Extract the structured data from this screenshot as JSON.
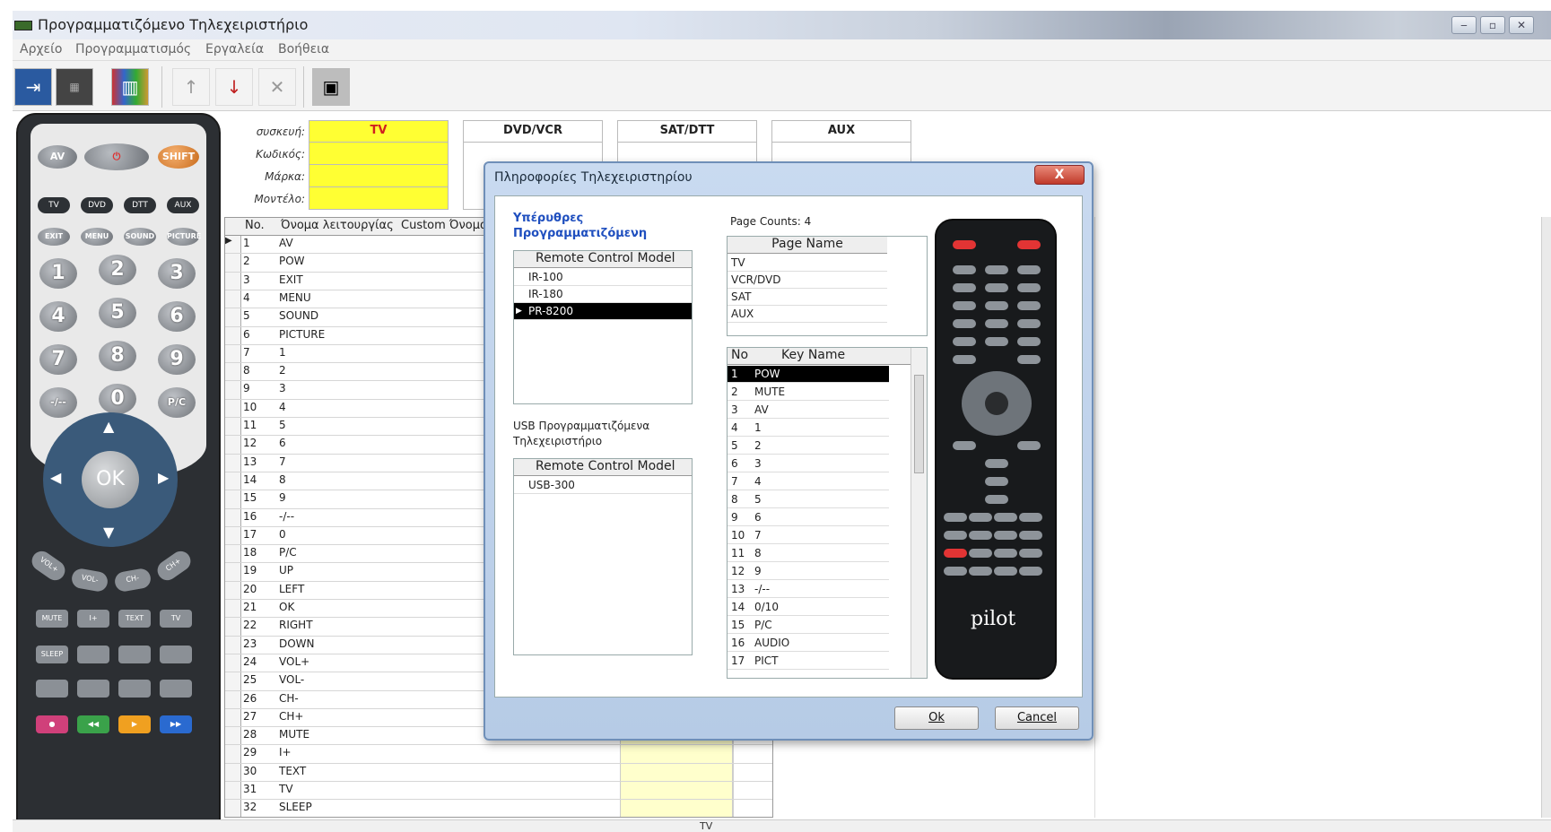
{
  "window": {
    "title": "Προγραμματιζόμενο Τηλεχειριστήριο",
    "controls": [
      "minimize",
      "maximize",
      "close"
    ]
  },
  "menu": [
    "Αρχείο",
    "Προγραμματισμός",
    "Εργαλεία",
    "Βοήθεια"
  ],
  "toolbar": {
    "buttons": [
      "import-icon",
      "chip-icon",
      "books-icon",
      "up-arrow-icon",
      "down-arrow-icon",
      "delete-icon",
      "gray-square-icon"
    ]
  },
  "device_fields": {
    "labels": [
      "συσκευή:",
      "Κωδικός:",
      "Μάρκα:",
      "Μοντέλο:"
    ],
    "tabs": [
      "TV",
      "DVD/VCR",
      "SAT/DTT",
      "AUX"
    ],
    "active_tab": "TV",
    "active_color": "#ffff33"
  },
  "grid": {
    "headers": [
      "No.",
      "Όνομα λειτουργίας",
      "Custom Όνομα"
    ],
    "rows": [
      [
        "1",
        "AV"
      ],
      [
        "2",
        "POW"
      ],
      [
        "3",
        "EXIT"
      ],
      [
        "4",
        "MENU"
      ],
      [
        "5",
        "SOUND"
      ],
      [
        "6",
        "PICTURE"
      ],
      [
        "7",
        "1"
      ],
      [
        "8",
        "2"
      ],
      [
        "9",
        "3"
      ],
      [
        "10",
        "4"
      ],
      [
        "11",
        "5"
      ],
      [
        "12",
        "6"
      ],
      [
        "13",
        "7"
      ],
      [
        "14",
        "8"
      ],
      [
        "15",
        "9"
      ],
      [
        "16",
        "-/--"
      ],
      [
        "17",
        "0"
      ],
      [
        "18",
        "P/C"
      ],
      [
        "19",
        "UP"
      ],
      [
        "20",
        "LEFT"
      ],
      [
        "21",
        "OK"
      ],
      [
        "22",
        "RIGHT"
      ],
      [
        "23",
        "DOWN"
      ],
      [
        "24",
        "VOL+"
      ],
      [
        "25",
        "VOL-"
      ],
      [
        "26",
        "CH-"
      ],
      [
        "27",
        "CH+"
      ],
      [
        "28",
        "MUTE"
      ],
      [
        "29",
        "I+"
      ],
      [
        "30",
        "TEXT"
      ],
      [
        "31",
        "TV"
      ],
      [
        "32",
        "SLEEP"
      ]
    ]
  },
  "left_remote": {
    "top_buttons": [
      "AV",
      "⏻",
      "SHIFT"
    ],
    "mode_buttons": [
      "TV",
      "DVD",
      "DTT",
      "AUX"
    ],
    "func_buttons": [
      "EXIT",
      "MENU",
      "SOUND",
      "PICTURE"
    ],
    "numbers": [
      "1",
      "2",
      "3",
      "4",
      "5",
      "6",
      "7",
      "8",
      "9",
      "-/--",
      "0",
      "P/C"
    ],
    "ok_label": "OK",
    "vol_ch": [
      "VOL+",
      "VOL-",
      "CH-",
      "CH+"
    ],
    "bottom_rows": [
      [
        "MUTE",
        "I+",
        "TEXT",
        "TV"
      ],
      [
        "SLEEP",
        "",
        "",
        ""
      ],
      [
        "",
        "",
        "",
        ""
      ]
    ],
    "transport_colors": [
      "#d0407a",
      "#3aa24a",
      "#f0a020",
      "#2a6ad0"
    ]
  },
  "dialog": {
    "title": "Πληροφορίες Τηλεχειριστηρίου",
    "close_label": "X",
    "section1_title": "Υπέρυθρες Προγραμματιζόμενη",
    "ir_header": "Remote Control Model",
    "ir_models": [
      "IR-100",
      "IR-180",
      "PR-8200"
    ],
    "ir_selected": 2,
    "section2_title": "USB Προγραμματιζόμενα Τηλεχειριστήριο",
    "usb_header": "Remote Control Model",
    "usb_models": [
      "USB-300"
    ],
    "page_counts": "Page Counts: 4",
    "page_header": "Page Name",
    "pages": [
      "TV",
      "VCR/DVD",
      "SAT",
      "AUX"
    ],
    "key_header_no": "No",
    "key_header_name": "Key Name",
    "keys": [
      [
        "1",
        "POW"
      ],
      [
        "2",
        "MUTE"
      ],
      [
        "3",
        "AV"
      ],
      [
        "4",
        "1"
      ],
      [
        "5",
        "2"
      ],
      [
        "6",
        "3"
      ],
      [
        "7",
        "4"
      ],
      [
        "8",
        "5"
      ],
      [
        "9",
        "6"
      ],
      [
        "10",
        "7"
      ],
      [
        "11",
        "8"
      ],
      [
        "12",
        "9"
      ],
      [
        "13",
        "-/--"
      ],
      [
        "14",
        "0/10"
      ],
      [
        "15",
        "P/C"
      ],
      [
        "16",
        "AUDIO"
      ],
      [
        "17",
        "PICT"
      ]
    ],
    "key_selected": 0,
    "ok_label": "Ok",
    "cancel_label": "Cancel",
    "remote_brand": "pilot"
  },
  "statusbar": {
    "left_text": "TV"
  }
}
